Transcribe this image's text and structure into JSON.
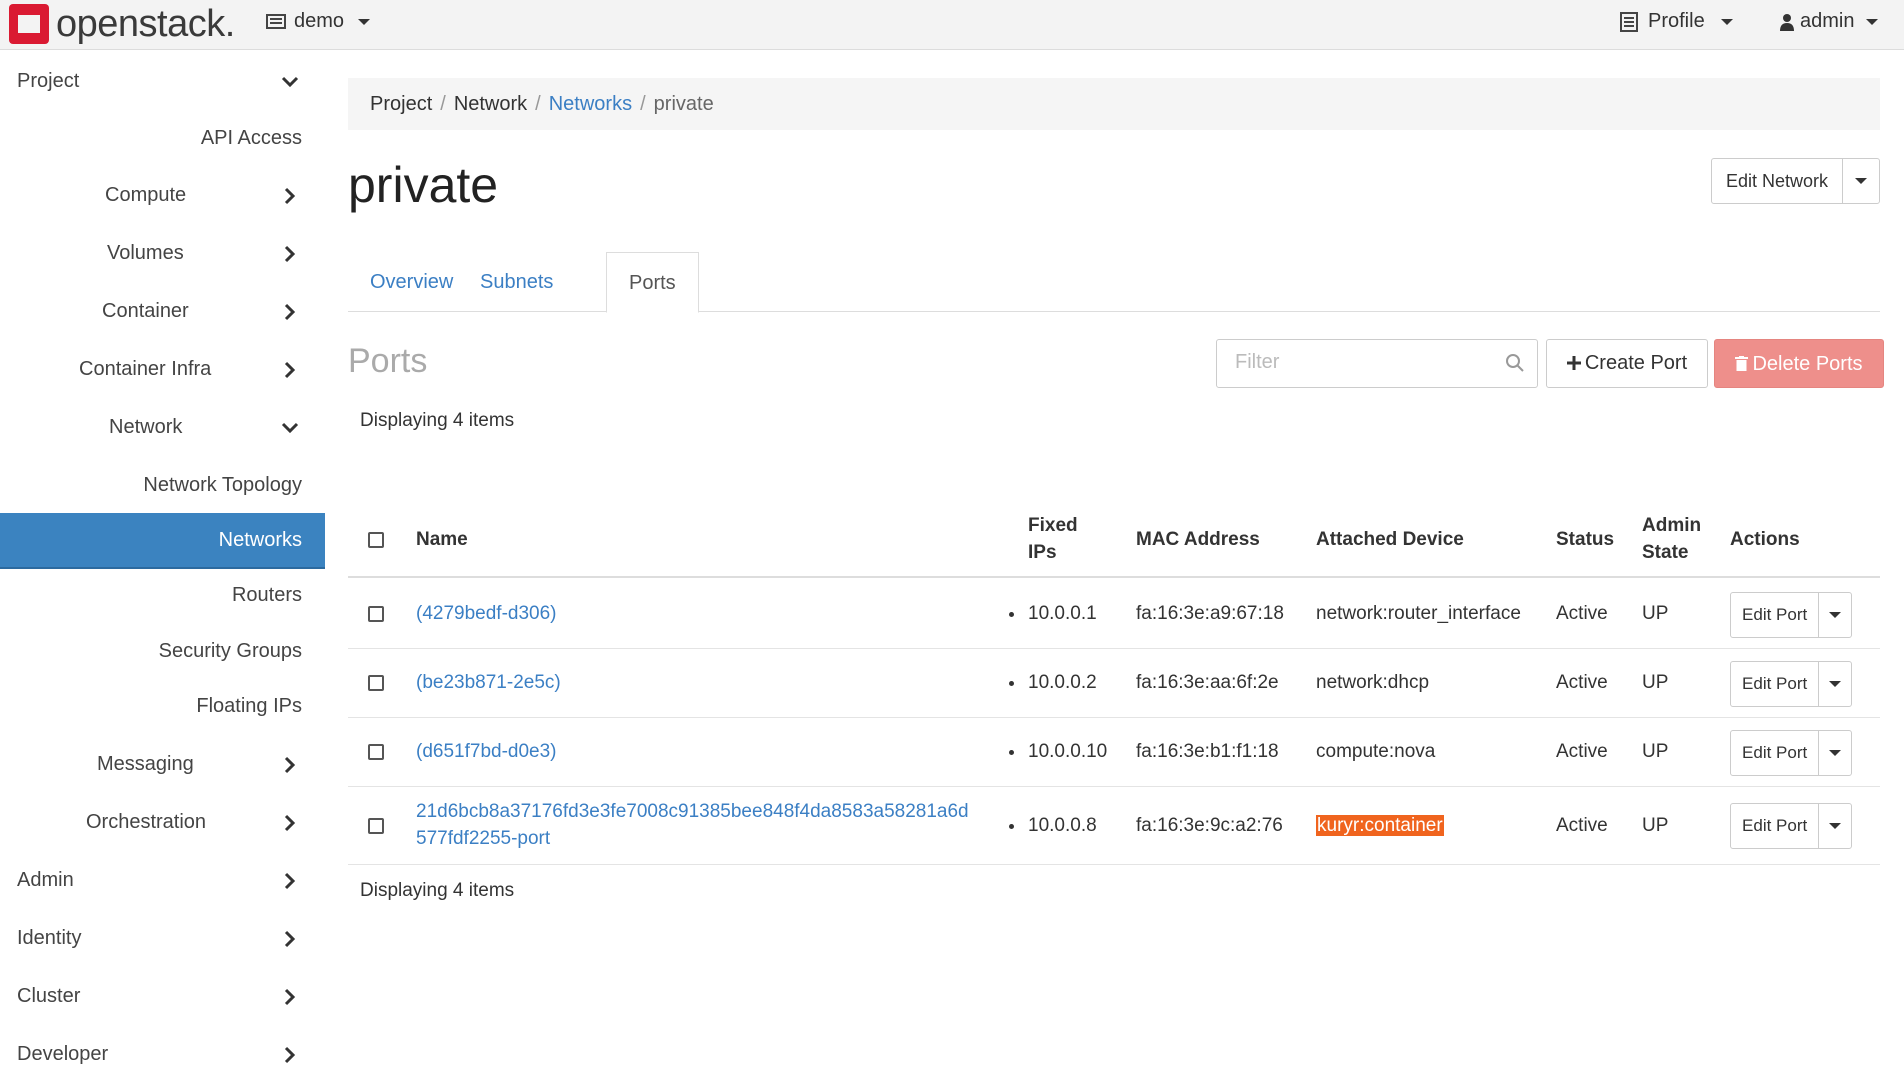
{
  "brand": {
    "name": "openstack."
  },
  "topbar": {
    "project_label": "demo",
    "profile_label": "Profile",
    "user_label": "admin"
  },
  "sidebar": {
    "items": [
      {
        "label": "Project"
      },
      {
        "label": "API Access"
      },
      {
        "label": "Compute"
      },
      {
        "label": "Volumes"
      },
      {
        "label": "Container"
      },
      {
        "label": "Container Infra"
      },
      {
        "label": "Network"
      },
      {
        "label": "Network Topology"
      },
      {
        "label": "Networks"
      },
      {
        "label": "Routers"
      },
      {
        "label": "Security Groups"
      },
      {
        "label": "Floating IPs"
      },
      {
        "label": "Messaging"
      },
      {
        "label": "Orchestration"
      },
      {
        "label": "Admin"
      },
      {
        "label": "Identity"
      },
      {
        "label": "Cluster"
      },
      {
        "label": "Developer"
      }
    ]
  },
  "breadcrumb": {
    "items": [
      "Project",
      "Network",
      "Networks",
      "private"
    ]
  },
  "page": {
    "title": "private",
    "edit_network_label": "Edit Network"
  },
  "tabs": [
    {
      "label": "Overview"
    },
    {
      "label": "Subnets"
    },
    {
      "label": "Ports"
    }
  ],
  "ports": {
    "section_title": "Ports",
    "filter_placeholder": "Filter",
    "create_label": "Create Port",
    "delete_label": "Delete Ports",
    "displaying_text": "Displaying 4 items",
    "columns": {
      "name": "Name",
      "fixed_ips_1": "Fixed",
      "fixed_ips_2": "IPs",
      "mac": "MAC Address",
      "device": "Attached Device",
      "status": "Status",
      "admin_1": "Admin",
      "admin_2": "State",
      "actions": "Actions"
    },
    "rows": [
      {
        "name": "(4279bedf-d306)",
        "ip": "10.0.0.1",
        "mac": "fa:16:3e:a9:67:18",
        "device": "network:router_interface",
        "status": "Active",
        "admin": "UP",
        "action": "Edit Port"
      },
      {
        "name": "(be23b871-2e5c)",
        "ip": "10.0.0.2",
        "mac": "fa:16:3e:aa:6f:2e",
        "device": "network:dhcp",
        "status": "Active",
        "admin": "UP",
        "action": "Edit Port"
      },
      {
        "name": "(d651f7bd-d0e3)",
        "ip": "10.0.0.10",
        "mac": "fa:16:3e:b1:f1:18",
        "device": "compute:nova",
        "status": "Active",
        "admin": "UP",
        "action": "Edit Port"
      },
      {
        "name_line1": "21d6bcb8a37176fd3e3fe7008c91385bee848f4da8583a58281a6d",
        "name_line2": "577fdf2255-port",
        "ip": "10.0.0.8",
        "mac": "fa:16:3e:9c:a2:76",
        "device": "kuryr:container",
        "status": "Active",
        "admin": "UP",
        "action": "Edit Port"
      }
    ]
  }
}
